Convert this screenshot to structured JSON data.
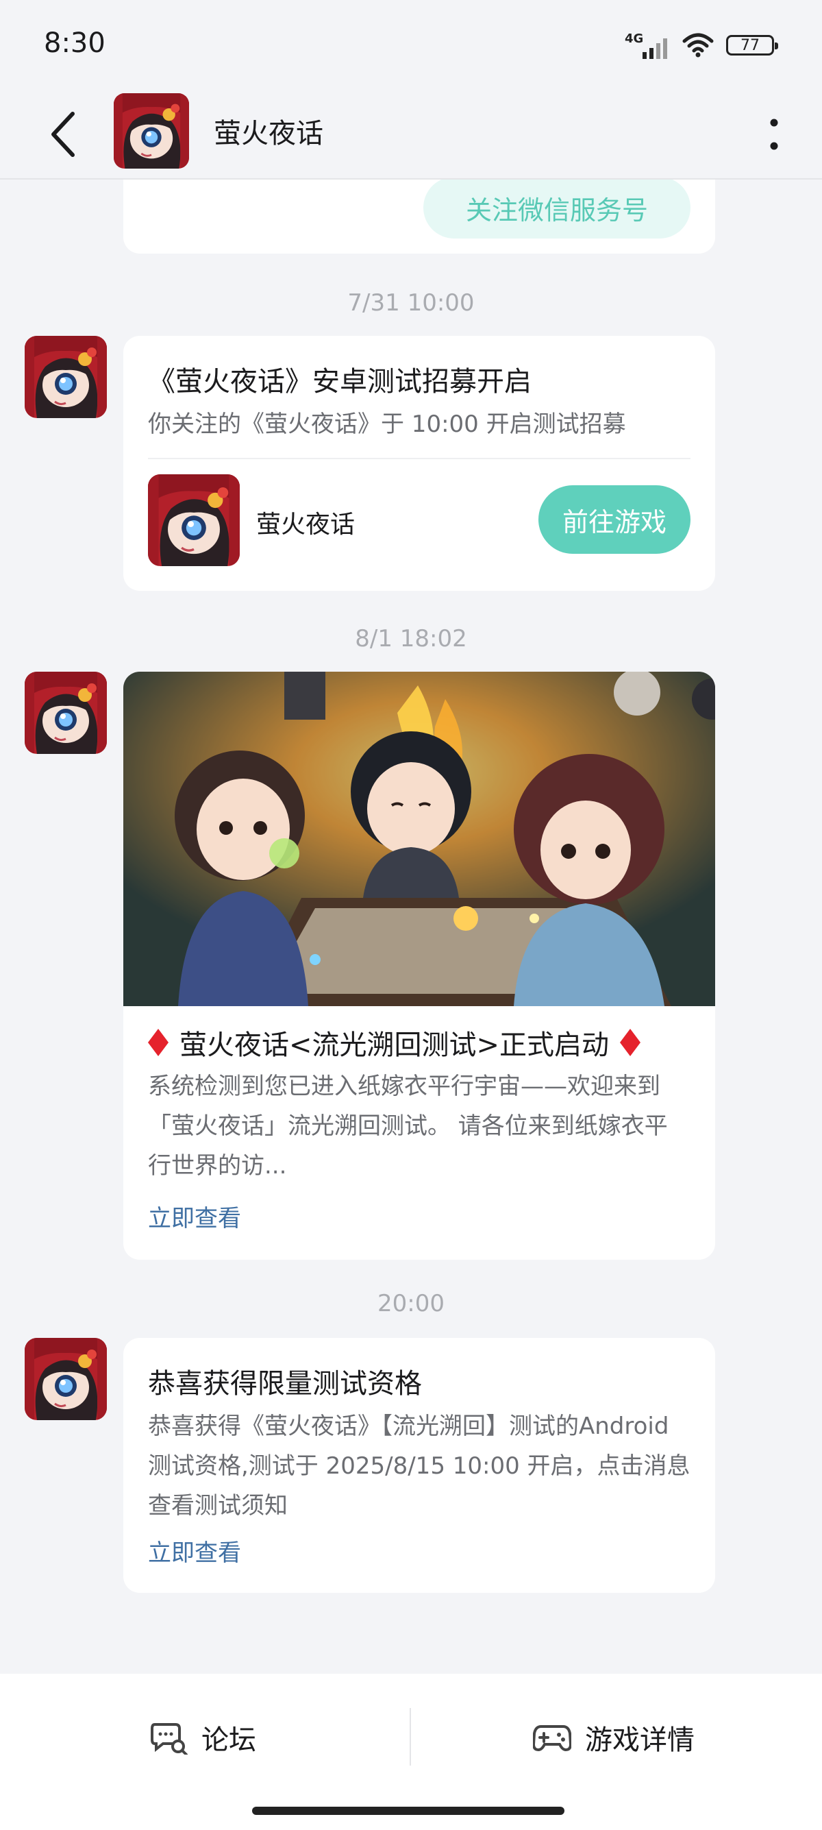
{
  "status_bar": {
    "time": "8:30",
    "network": "4G",
    "battery": "77"
  },
  "header": {
    "title": "萤火夜话",
    "back_icon": "back-arrow-icon",
    "more_icon": "more-vertical-icon"
  },
  "messages": {
    "top_card": {
      "follow_button": "关注微信服务号"
    },
    "msg1": {
      "timestamp": "7/31  10:00",
      "title": "《萤火夜话》安卓测试招募开启",
      "desc": "你关注的《萤火夜话》于 10:00 开启测试招募",
      "game_name": "萤火夜话",
      "button": "前往游戏"
    },
    "msg2": {
      "timestamp": "8/1  18:02",
      "title": "萤火夜话<流光溯回测试>正式启动",
      "desc": "系统检测到您已进入纸嫁衣平行宇宙——欢迎来到「萤火夜话」流光溯回测试。 请各位来到纸嫁衣平行世界的访...",
      "link": "立即查看"
    },
    "msg3": {
      "timestamp": "20:00",
      "title": "恭喜获得限量测试资格",
      "desc": "恭喜获得《萤火夜话》【流光溯回】测试的Android测试资格,测试于 2025/8/15 10:00 开启，点击消息查看测试须知",
      "link": "立即查看"
    }
  },
  "bottom_bar": {
    "forum_label": "论坛",
    "details_label": "游戏详情"
  },
  "colors": {
    "accent_teal": "#5fd0bc",
    "link_blue": "#3f6fa3",
    "background": "#f3f4f7",
    "diamond_red": "#e5222c"
  }
}
